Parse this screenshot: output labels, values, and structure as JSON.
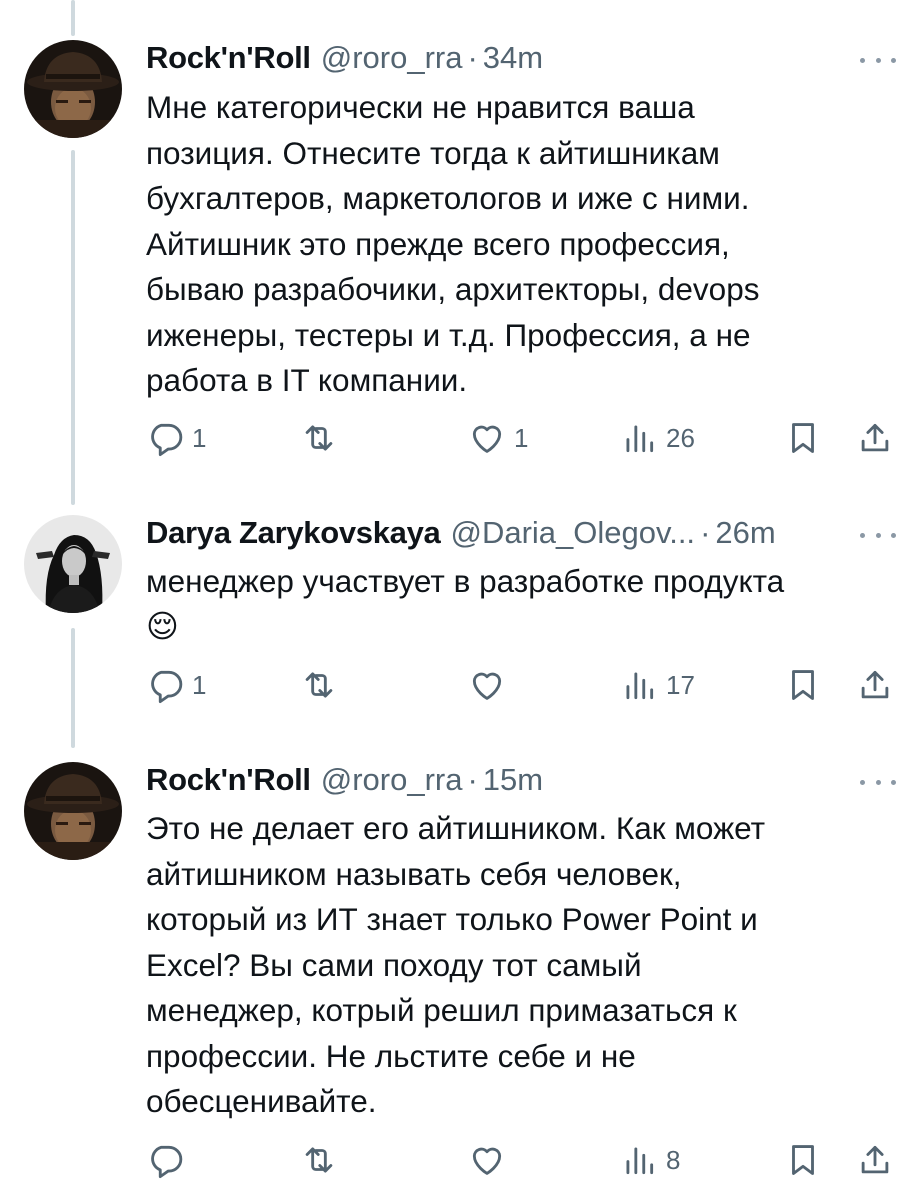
{
  "tweets": [
    {
      "name": "Rock'n'Roll",
      "handle": "@roro_rra",
      "separator": "·",
      "time": "34m",
      "avatar": "fedora-man-avatar",
      "lines": [
        "Мне категорически не нравится ваша",
        "позиция. Отнесите тогда к айтишникам",
        "бухгалтеров, маркетологов и иже с ними.",
        "Айтишник это прежде всего профессия,",
        "бываю разрабочики, архитекторы, devops",
        "иженеры, тестеры и т.д. Профессия, а не",
        "работа в IT компании."
      ],
      "reply_count": "1",
      "retweet_count": "",
      "like_count": "1",
      "views_count": "26"
    },
    {
      "name": "Darya Zarykovskaya",
      "handle": "@Daria_Olegov...",
      "separator": "·",
      "time": "26m",
      "avatar": "woman-portrait-avatar",
      "lines": [
        "менеджер участвует в разработке продукта"
      ],
      "emoji": "😌",
      "reply_count": "1",
      "retweet_count": "",
      "like_count": "",
      "views_count": "17"
    },
    {
      "name": "Rock'n'Roll",
      "handle": "@roro_rra",
      "separator": "·",
      "time": "15m",
      "avatar": "fedora-man-avatar",
      "lines": [
        "Это не делает его айтишником. Как может",
        "айтишником называть себя человек,",
        "который из ИТ знает только Power Point и",
        "Excel? Вы сами походу тот самый",
        "менеджер, котрый решил примазаться к",
        "профессии. Не льстите себе и не",
        "обесценивайте."
      ],
      "reply_count": "",
      "retweet_count": "",
      "like_count": "",
      "views_count": "8"
    }
  ],
  "colors": {
    "text": "#0f1419",
    "secondary": "#536471",
    "thread_line": "#cfd9de"
  },
  "icons": [
    "reply-icon",
    "retweet-icon",
    "like-icon",
    "views-icon",
    "bookmark-icon",
    "share-icon",
    "more-icon"
  ]
}
